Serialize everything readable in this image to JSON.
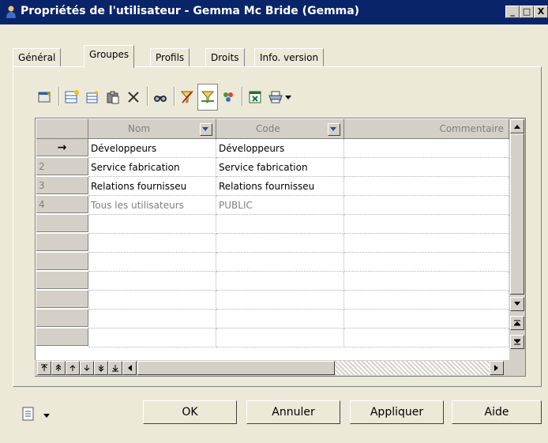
{
  "window": {
    "title": "Propriétés de l'utilisateur - Gemma Mc Bride (Gemma)",
    "controls": [
      "_",
      "□",
      "X"
    ]
  },
  "tabs": [
    {
      "label": "Général",
      "active": false
    },
    {
      "label": "Groupes",
      "active": true
    },
    {
      "label": "Profils",
      "active": false
    },
    {
      "label": "Droits",
      "active": false
    },
    {
      "label": "Info. version",
      "active": false
    }
  ],
  "toolbar": {
    "icons": [
      "properties-icon",
      "add-rows-icon",
      "create-object-icon",
      "paste-icon",
      "delete-icon",
      "find-icon",
      "filter-icon",
      "customize-columns-icon",
      "filter-settings-icon",
      "export-excel-icon",
      "print-icon",
      "dropdown-arrow-icon"
    ]
  },
  "grid": {
    "columns": [
      {
        "label": "Nom"
      },
      {
        "label": "Code"
      },
      {
        "label": "Commentaire"
      }
    ],
    "rows": [
      {
        "marker": "→",
        "name": "Développeurs",
        "code": "Développeurs",
        "comment": "",
        "disabled": false
      },
      {
        "marker": "2",
        "name": "Service fabrication",
        "code": "Service fabrication",
        "comment": "",
        "disabled": false
      },
      {
        "marker": "3",
        "name": "Relations fournisseu",
        "code": "Relations fournisseu",
        "comment": "",
        "disabled": false
      },
      {
        "marker": "4",
        "name": "Tous les utilisateurs",
        "code": "PUBLIC",
        "comment": "",
        "disabled": true
      }
    ]
  },
  "buttons": {
    "ok": "OK",
    "cancel": "Annuler",
    "apply": "Appliquer",
    "help": "Aide"
  }
}
